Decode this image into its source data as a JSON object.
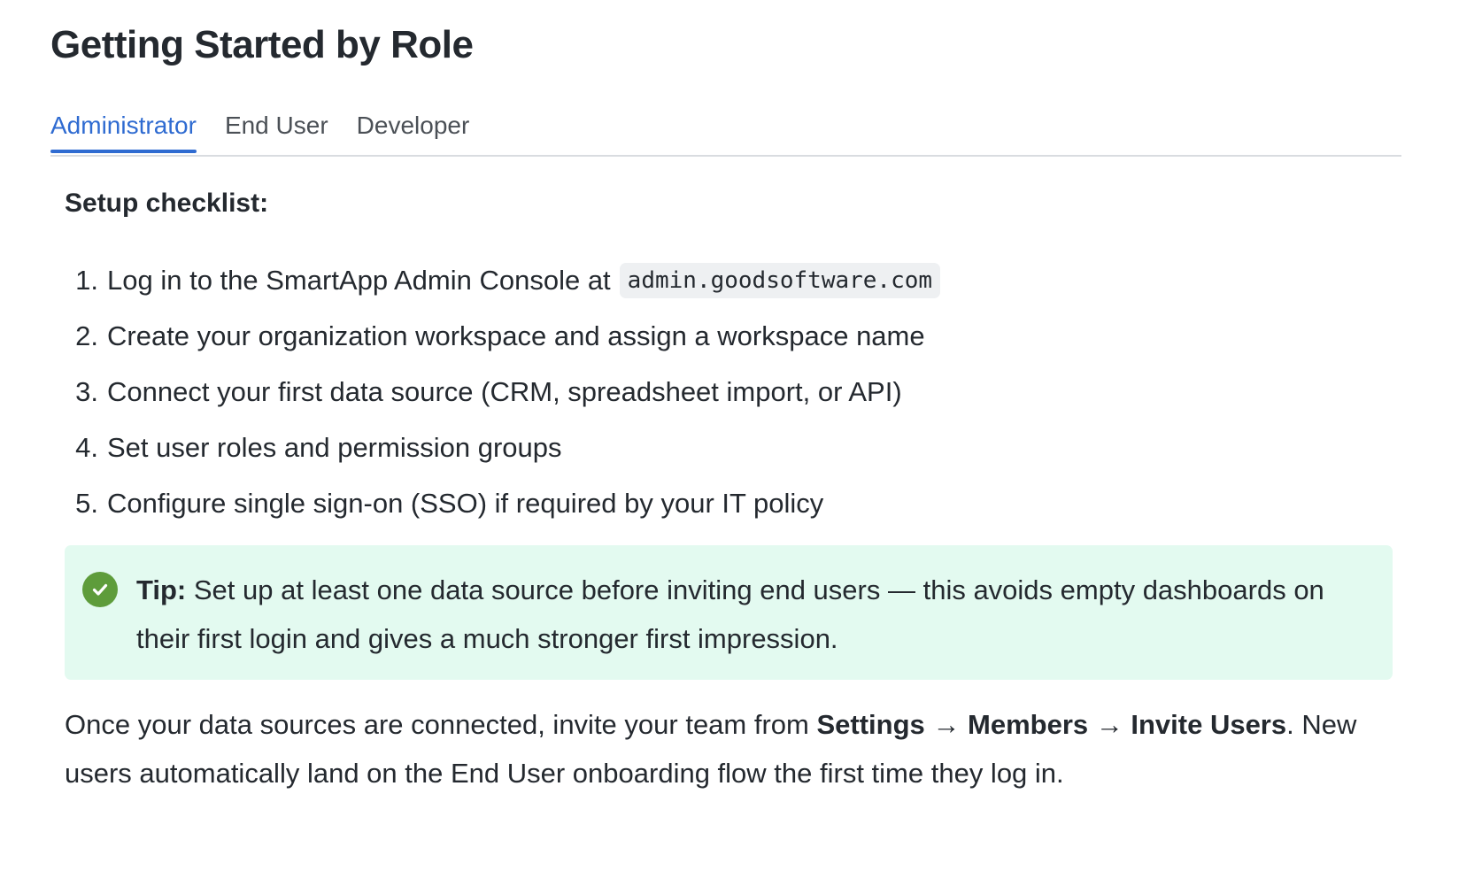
{
  "page": {
    "title": "Getting Started by Role"
  },
  "tabs": [
    {
      "label": "Administrator",
      "active": true
    },
    {
      "label": "End User",
      "active": false
    },
    {
      "label": "Developer",
      "active": false
    }
  ],
  "admin": {
    "heading": "Setup checklist:",
    "steps": [
      {
        "num": "1.",
        "text": "Log in to the SmartApp Admin Console at",
        "code": "admin.goodsoftware.com"
      },
      {
        "num": "2.",
        "text": "Create your organization workspace and assign a workspace name"
      },
      {
        "num": "3.",
        "text": "Connect your first data source (CRM, spreadsheet import, or API)"
      },
      {
        "num": "4.",
        "text": "Set user roles and permission groups"
      },
      {
        "num": "5.",
        "text": "Configure single sign-on (SSO) if required by your IT policy"
      }
    ],
    "tip": {
      "label": "Tip:",
      "text": " Set up at least one data source before inviting end users — this avoids empty dashboards on their first login and gives a much stronger first impression.",
      "icon": "check-circle-icon",
      "color": "#5e9c3b",
      "background": "#e3faf0"
    },
    "outro": {
      "before": "Once your data sources are connected, invite your team from ",
      "path_settings": "Settings",
      "arrow": " → ",
      "path_members": "Members",
      "path_invite": "Invite Users",
      "after": ". New users automatically land on the End User onboarding flow the first time they log in."
    }
  },
  "colors": {
    "accent": "#2f6bd1",
    "text": "#24292f",
    "tab_inactive": "#4b5056",
    "divider": "#d9dce0"
  }
}
